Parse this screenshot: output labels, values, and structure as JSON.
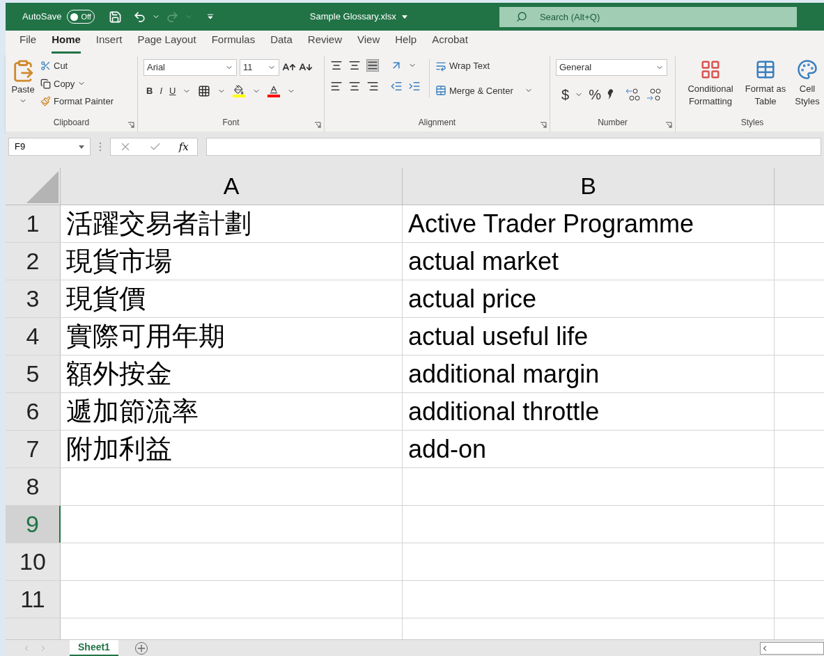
{
  "title_bar": {
    "autosave_label": "AutoSave",
    "autosave": {
      "on": false,
      "label": "Off"
    },
    "file_name": "Sample Glossary.xlsx",
    "search": {
      "placeholder": "Search (Alt+Q)"
    }
  },
  "menu_tabs": [
    {
      "label": "File",
      "selected": false
    },
    {
      "label": "Home",
      "selected": true
    },
    {
      "label": "Insert",
      "selected": false
    },
    {
      "label": "Page Layout",
      "selected": false
    },
    {
      "label": "Formulas",
      "selected": false
    },
    {
      "label": "Data",
      "selected": false
    },
    {
      "label": "Review",
      "selected": false
    },
    {
      "label": "View",
      "selected": false
    },
    {
      "label": "Help",
      "selected": false
    },
    {
      "label": "Acrobat",
      "selected": false
    }
  ],
  "ribbon": {
    "clipboard": {
      "label": "Clipboard",
      "paste": "Paste",
      "cut": "Cut",
      "copy": "Copy",
      "format_painter": "Format Painter"
    },
    "font": {
      "label": "Font",
      "font_name": "Arial",
      "font_size": "11",
      "bold": "B",
      "italic": "I",
      "underline": "U"
    },
    "alignment": {
      "label": "Alignment",
      "wrap_text": "Wrap Text",
      "merge_center": "Merge & Center"
    },
    "number": {
      "label": "Number",
      "format": "General",
      "currency": "$",
      "percent": "%"
    },
    "styles": {
      "label": "Styles",
      "buttons": [
        "Conditional Formatting",
        "Format as Table",
        "Cell Styles"
      ]
    }
  },
  "formula_bar": {
    "name_box": "F9",
    "fx": "fx"
  },
  "grid": {
    "columns": [
      "A",
      "B"
    ],
    "rows": [
      {
        "number": "1",
        "a": "活躍交易者計劃",
        "b": "Active Trader Programme",
        "selected": false
      },
      {
        "number": "2",
        "a": "現貨市場",
        "b": "actual market",
        "selected": false
      },
      {
        "number": "3",
        "a": "現貨價",
        "b": "actual price",
        "selected": false
      },
      {
        "number": "4",
        "a": "實際可用年期",
        "b": "actual useful life",
        "selected": false
      },
      {
        "number": "5",
        "a": "額外按金",
        "b": "additional margin",
        "selected": false
      },
      {
        "number": "6",
        "a": "遞加節流率",
        "b": "additional throttle",
        "selected": false
      },
      {
        "number": "7",
        "a": "附加利益",
        "b": "add-on",
        "selected": false
      },
      {
        "number": "8",
        "selected": false
      },
      {
        "number": "9",
        "selected": true
      },
      {
        "number": "10",
        "selected": false
      },
      {
        "number": "11",
        "selected": false
      },
      {
        "selected": false
      }
    ]
  },
  "sheet_tabs": [
    {
      "label": "Sheet1",
      "selected": true
    }
  ]
}
